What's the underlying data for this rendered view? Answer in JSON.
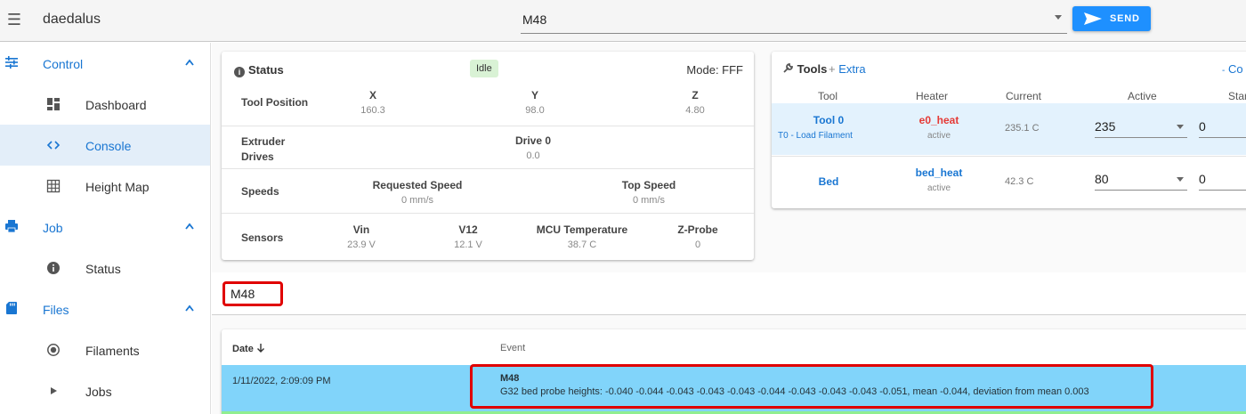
{
  "app": {
    "title": "daedalus"
  },
  "toolbar": {
    "command_value": "M48",
    "send_label": "SEND"
  },
  "sidebar": {
    "groups": [
      {
        "label": "Control",
        "items": [
          {
            "label": "Dashboard"
          },
          {
            "label": "Console"
          },
          {
            "label": "Height Map"
          }
        ]
      },
      {
        "label": "Job",
        "items": [
          {
            "label": "Status"
          }
        ]
      },
      {
        "label": "Files",
        "items": [
          {
            "label": "Filaments"
          },
          {
            "label": "Jobs"
          }
        ]
      }
    ]
  },
  "status": {
    "title": "Status",
    "state": "Idle",
    "mode": "Mode: FFF",
    "rows": [
      {
        "label": "Tool Position",
        "cols": [
          {
            "h": "X",
            "v": "160.3"
          },
          {
            "h": "Y",
            "v": "98.0"
          },
          {
            "h": "Z",
            "v": "4.80"
          }
        ]
      },
      {
        "label_line1": "Extruder",
        "label_line2": "Drives",
        "cols": [
          {
            "h": "Drive 0",
            "v": "0.0"
          }
        ]
      },
      {
        "label": "Speeds",
        "cols": [
          {
            "h": "Requested Speed",
            "v": "0 mm/s"
          },
          {
            "h": "Top Speed",
            "v": "0 mm/s"
          }
        ]
      },
      {
        "label": "Sensors",
        "cols": [
          {
            "h": "Vin",
            "v": "23.9 V"
          },
          {
            "h": "V12",
            "v": "12.1 V"
          },
          {
            "h": "MCU Temperature",
            "v": "38.7 C"
          },
          {
            "h": "Z-Probe",
            "v": "0"
          }
        ]
      }
    ]
  },
  "tools": {
    "title": "Tools",
    "extra_label": "Extra",
    "co_label": "Co",
    "columns": [
      "Tool",
      "Heater",
      "Current",
      "Active",
      "Star"
    ],
    "rows": [
      {
        "tool": "Tool 0",
        "tool_sub": "T0 - Load Filament",
        "heater": "e0_heat",
        "heater_color": "#e53935",
        "heater_state": "active",
        "current": "235.1 C",
        "active": "235",
        "standby": "0"
      },
      {
        "tool": "Bed",
        "heater": "bed_heat",
        "heater_color": "#1976d2",
        "heater_state": "active",
        "current": "42.3 C",
        "active": "80",
        "standby": "0"
      }
    ]
  },
  "console": {
    "input_value": "M48"
  },
  "events": {
    "col_date": "Date",
    "col_event": "Event",
    "rows": [
      {
        "date": "1/11/2022, 2:09:09 PM",
        "command": "M48",
        "message": "G32 bed probe heights: -0.040 -0.044 -0.043 -0.043 -0.043 -0.044 -0.043 -0.043 -0.043 -0.051, mean -0.044, deviation from mean 0.003"
      }
    ]
  },
  "colors": {
    "accent": "#1976d2",
    "send": "#1e90ff",
    "highlight": "#e00000",
    "event_row": "#81d4fa",
    "idle_chip": "#d9f2d5"
  }
}
